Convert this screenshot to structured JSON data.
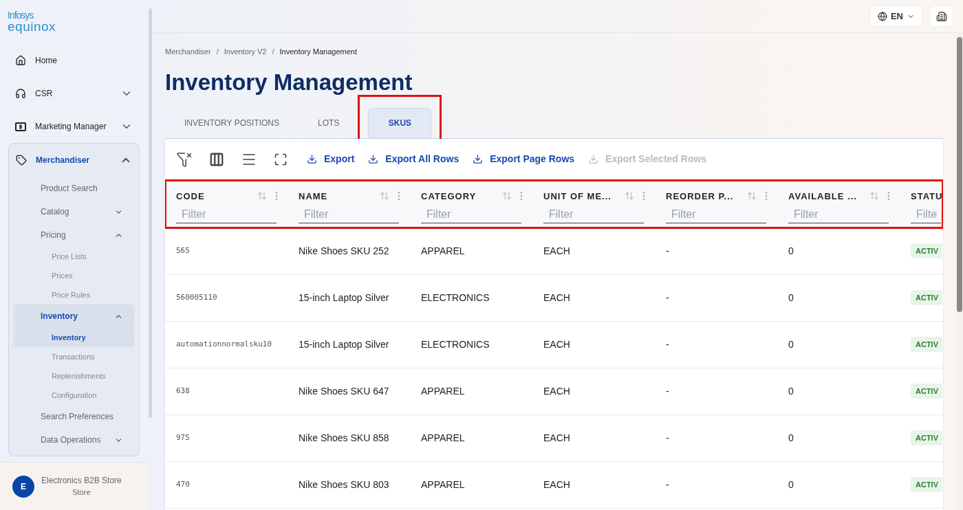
{
  "logo": {
    "top": "Infosys",
    "bottom": "equinox"
  },
  "sidebar": {
    "items": [
      {
        "label": "Home",
        "selected": false
      },
      {
        "label": "CSR",
        "expanded": false,
        "selected": false
      },
      {
        "label": "Marketing Manager",
        "expanded": false,
        "selected": false
      },
      {
        "label": "Merchandiser",
        "expanded": true,
        "selected": true,
        "children": [
          {
            "label": "Product Search",
            "selected": false
          },
          {
            "label": "Catalog",
            "expanded": false,
            "selected": false
          },
          {
            "label": "Pricing",
            "expanded": true,
            "selected": false,
            "children": [
              {
                "label": "Price Lists",
                "selected": false
              },
              {
                "label": "Prices",
                "selected": false
              },
              {
                "label": "Price Rules",
                "selected": false
              }
            ]
          },
          {
            "label": "Inventory",
            "expanded": true,
            "selected": true,
            "children": [
              {
                "label": "Inventory",
                "selected": true
              },
              {
                "label": "Transactions",
                "selected": false
              },
              {
                "label": "Replenishments",
                "selected": false
              },
              {
                "label": "Configuration",
                "selected": false
              }
            ]
          },
          {
            "label": "Search Preferences",
            "selected": false
          },
          {
            "label": "Data Operations",
            "expanded": false,
            "selected": false
          }
        ]
      }
    ]
  },
  "store": {
    "initial": "E",
    "name": "Electronics B2B Store",
    "type": "Store"
  },
  "topbar": {
    "language": "EN"
  },
  "breadcrumb": {
    "separator": "/",
    "items": [
      "Merchandiser",
      "Inventory V2",
      "Inventory Management"
    ]
  },
  "title": "Inventory Management",
  "tabs": [
    {
      "label": "INVENTORY POSITIONS",
      "selected": false,
      "highlighted": false
    },
    {
      "label": "LOTS",
      "selected": false,
      "highlighted": false
    },
    {
      "label": "SKUS",
      "selected": true,
      "highlighted": true
    }
  ],
  "toolbar": {
    "actions": [
      {
        "label": "Export",
        "disabled": false
      },
      {
        "label": "Export All Rows",
        "disabled": false
      },
      {
        "label": "Export Page Rows",
        "disabled": false
      },
      {
        "label": "Export Selected Rows",
        "disabled": true
      }
    ]
  },
  "table": {
    "header_highlighted": true,
    "columns": [
      {
        "label": "CODE",
        "placeholder": "Filter"
      },
      {
        "label": "NAME",
        "placeholder": "Filter"
      },
      {
        "label": "CATEGORY",
        "placeholder": "Filter"
      },
      {
        "label": "UNIT OF ME...",
        "placeholder": "Filter"
      },
      {
        "label": "REORDER P...",
        "placeholder": "Filter"
      },
      {
        "label": "AVAILABLE ...",
        "placeholder": "Filter"
      },
      {
        "label": "STATU",
        "placeholder": "Filte"
      }
    ],
    "rows": [
      {
        "code": "565",
        "name": "Nike Shoes SKU 252",
        "category": "APPAREL",
        "unit": "EACH",
        "reorder": "-",
        "available": "0",
        "status": "ACTIV"
      },
      {
        "code": "560005110",
        "name": "15-inch Laptop Silver",
        "category": "ELECTRONICS",
        "unit": "EACH",
        "reorder": "-",
        "available": "0",
        "status": "ACTIV"
      },
      {
        "code": "automationnormalsku10",
        "name": "15-inch Laptop Silver",
        "category": "ELECTRONICS",
        "unit": "EACH",
        "reorder": "-",
        "available": "0",
        "status": "ACTIV"
      },
      {
        "code": "638",
        "name": "Nike Shoes SKU 647",
        "category": "APPAREL",
        "unit": "EACH",
        "reorder": "-",
        "available": "0",
        "status": "ACTIV"
      },
      {
        "code": "975",
        "name": "Nike Shoes SKU 858",
        "category": "APPAREL",
        "unit": "EACH",
        "reorder": "-",
        "available": "0",
        "status": "ACTIV"
      },
      {
        "code": "470",
        "name": "Nike Shoes SKU 803",
        "category": "APPAREL",
        "unit": "EACH",
        "reorder": "-",
        "available": "0",
        "status": "ACTIV"
      }
    ]
  }
}
